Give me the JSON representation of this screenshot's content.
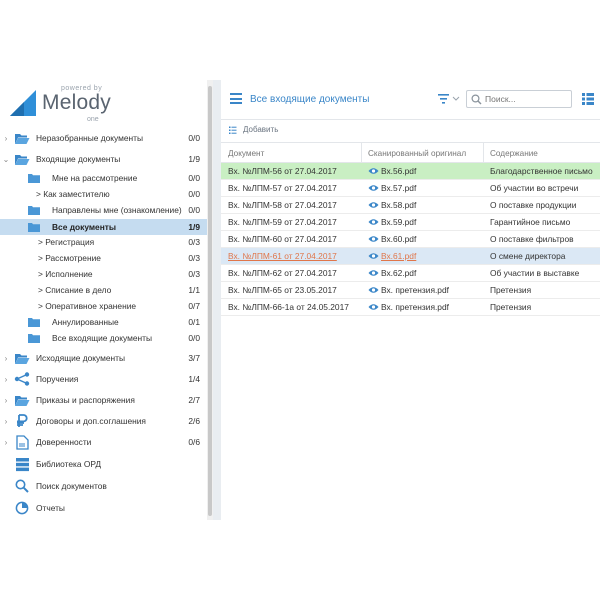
{
  "logo": {
    "powered": "powered by",
    "name": "Melody",
    "edition": "one"
  },
  "sidebar": {
    "items": [
      {
        "label": "Неразобранные документы",
        "count": "0/0",
        "arrow": "›",
        "icon": "folder-open-icon"
      },
      {
        "label": "Входящие документы",
        "count": "1/9",
        "arrow": "⌄",
        "icon": "folder-open-icon"
      },
      {
        "label": "Мне на рассмотрение",
        "count": "0/0",
        "icon": "folder-icon"
      },
      {
        "label": "> Как заместителю",
        "count": "0/0"
      },
      {
        "label": "Направлены мне (ознакомление)",
        "count": "0/0",
        "icon": "folder-icon"
      },
      {
        "label": "Все документы",
        "count": "1/9",
        "icon": "folder-icon",
        "active": true
      },
      {
        "label": "> Регистрация",
        "count": "0/3"
      },
      {
        "label": "> Рассмотрение",
        "count": "0/3"
      },
      {
        "label": "> Исполнение",
        "count": "0/3"
      },
      {
        "label": "> Списание в дело",
        "count": "1/1"
      },
      {
        "label": "> Оперативное хранение",
        "count": "0/7"
      },
      {
        "label": "Аннулированные",
        "count": "0/1",
        "icon": "folder-icon"
      },
      {
        "label": "Все входящие документы",
        "count": "0/0",
        "icon": "folder-icon"
      },
      {
        "label": "Исходящие документы",
        "count": "3/7",
        "arrow": "›",
        "icon": "folder-open-icon"
      },
      {
        "label": "Поручения",
        "count": "1/4",
        "arrow": "›",
        "icon": "share-icon"
      },
      {
        "label": "Приказы и распоряжения",
        "count": "2/7",
        "arrow": "›",
        "icon": "folder-open-icon"
      },
      {
        "label": "Договоры и доп.соглашения",
        "count": "2/6",
        "arrow": "›",
        "icon": "ruble-icon"
      },
      {
        "label": "Доверенности",
        "count": "0/6",
        "arrow": "›",
        "icon": "document-icon"
      },
      {
        "label": "Библиотека ОРД",
        "count": "",
        "icon": "library-icon"
      },
      {
        "label": "Поиск документов",
        "count": "",
        "icon": "search-icon"
      },
      {
        "label": "Отчеты",
        "count": "",
        "icon": "pie-chart-icon"
      }
    ]
  },
  "toolbar": {
    "title": "Все входящие документы",
    "search_placeholder": "Поиск..."
  },
  "actions": {
    "add_label": "Добавить"
  },
  "table": {
    "columns": [
      "Документ",
      "Сканированный оригинал",
      "Содержание"
    ],
    "rows": [
      {
        "doc": "Вх. №ЛПМ-56 от 27.04.2017",
        "scan": "Вх.56.pdf",
        "content": "Благодарственное письмо",
        "state": "green"
      },
      {
        "doc": "Вх. №ЛПМ-57 от 27.04.2017",
        "scan": "Вх.57.pdf",
        "content": "Об участии во встречи"
      },
      {
        "doc": "Вх. №ЛПМ-58 от 27.04.2017",
        "scan": "Вх.58.pdf",
        "content": "О поставке продукции"
      },
      {
        "doc": "Вх. №ЛПМ-59 от 27.04.2017",
        "scan": "Вх.59.pdf",
        "content": "Гарантийное письмо"
      },
      {
        "doc": "Вх. №ЛПМ-60 от 27.04.2017",
        "scan": "Вх.60.pdf",
        "content": "О поставке фильтров"
      },
      {
        "doc": "Вх. №ЛПМ-61 от 27.04.2017",
        "scan": "Вх.61.pdf",
        "content": "О смене директора",
        "state": "blue"
      },
      {
        "doc": "Вх. №ЛПМ-62 от 27.04.2017",
        "scan": "Вх.62.pdf",
        "content": "Об участии в выставке"
      },
      {
        "doc": "Вх. №ЛПМ-65 от 23.05.2017",
        "scan": "Вх. претензия.pdf",
        "content": "Претензия"
      },
      {
        "doc": "Вх. №ЛПМ-66-1а от 24.05.2017",
        "scan": "Вх. претензия.pdf",
        "content": "Претензия"
      }
    ]
  },
  "colors": {
    "accent": "#3a86c8",
    "active_row": "#c5dcf0",
    "highlight_green": "#c9efc3",
    "highlight_blue": "#dbe8f5",
    "link_orange": "#e0764a"
  }
}
